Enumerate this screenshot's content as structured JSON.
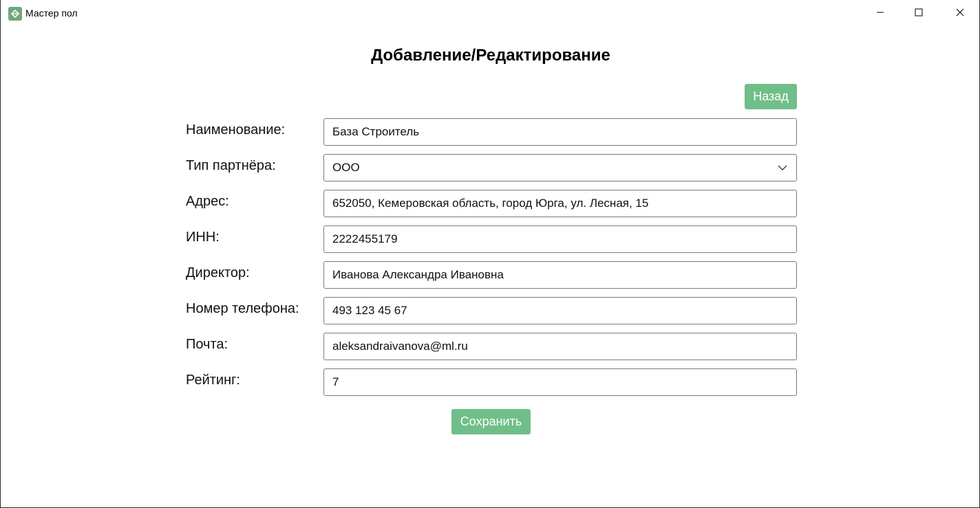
{
  "window": {
    "title": "Мастер пол"
  },
  "form": {
    "heading": "Добавление/Редактирование",
    "back_label": "Назад",
    "save_label": "Сохранить",
    "fields": {
      "name": {
        "label": "Наименование:",
        "value": "База Строитель"
      },
      "partner_type": {
        "label": "Тип партнёра:",
        "value": "ООО"
      },
      "address": {
        "label": "Адрес:",
        "value": "652050, Кемеровская область, город Юрга, ул. Лесная, 15"
      },
      "inn": {
        "label": "ИНН:",
        "value": "2222455179"
      },
      "director": {
        "label": "Директор:",
        "value": "Иванова Александра Ивановна"
      },
      "phone": {
        "label": "Номер телефона:",
        "value": "493 123 45 67"
      },
      "email": {
        "label": "Почта:",
        "value": "aleksandraivanova@ml.ru"
      },
      "rating": {
        "label": "Рейтинг:",
        "value": "7"
      }
    }
  },
  "colors": {
    "accent": "#70bf88",
    "app_icon": "#6fa87a"
  },
  "icons": {
    "app": "app-logo-icon",
    "minimize": "minimize-icon",
    "maximize": "maximize-icon",
    "close": "close-icon",
    "dropdown": "chevron-down-icon"
  }
}
